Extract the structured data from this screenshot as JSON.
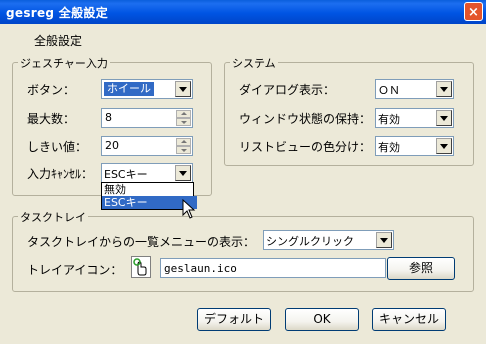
{
  "window": {
    "title": "gesreg 全般設定",
    "close_glyph": "×"
  },
  "tab": {
    "label": "全般設定"
  },
  "gesture": {
    "group_label": "ジェスチャー入力",
    "button_label": "ボタン：",
    "button_value": "ホイール",
    "max_label": "最大数：",
    "max_value": "8",
    "threshold_label": "しきい値：",
    "threshold_value": "20",
    "cancel_label": "入力ｷｬﾝｾﾙ：",
    "cancel_value": "ESCキー",
    "cancel_options": [
      "無効",
      "ESCキー"
    ]
  },
  "system": {
    "group_label": "システム",
    "dialog_label": "ダイアログ表示：",
    "dialog_value": "ＯＮ",
    "window_state_label": "ウィンドウ状態の保持：",
    "window_state_value": "有効",
    "listview_label": "リストビューの色分け：",
    "listview_value": "有効"
  },
  "tray": {
    "group_label": "タスクトレイ",
    "menu_label": "タスクトレイからの一覧メニューの表示：",
    "menu_value": "シングルクリック",
    "icon_label": "トレイアイコン：",
    "icon_file": "geslaun.ico",
    "browse_label": "参照"
  },
  "footer": {
    "default_label": "デフォルト",
    "ok_label": "OK",
    "cancel_label": "キャンセル"
  },
  "colors": {
    "titlebar": "#0054e3",
    "face": "#ece9d8",
    "selection": "#316ac5"
  }
}
